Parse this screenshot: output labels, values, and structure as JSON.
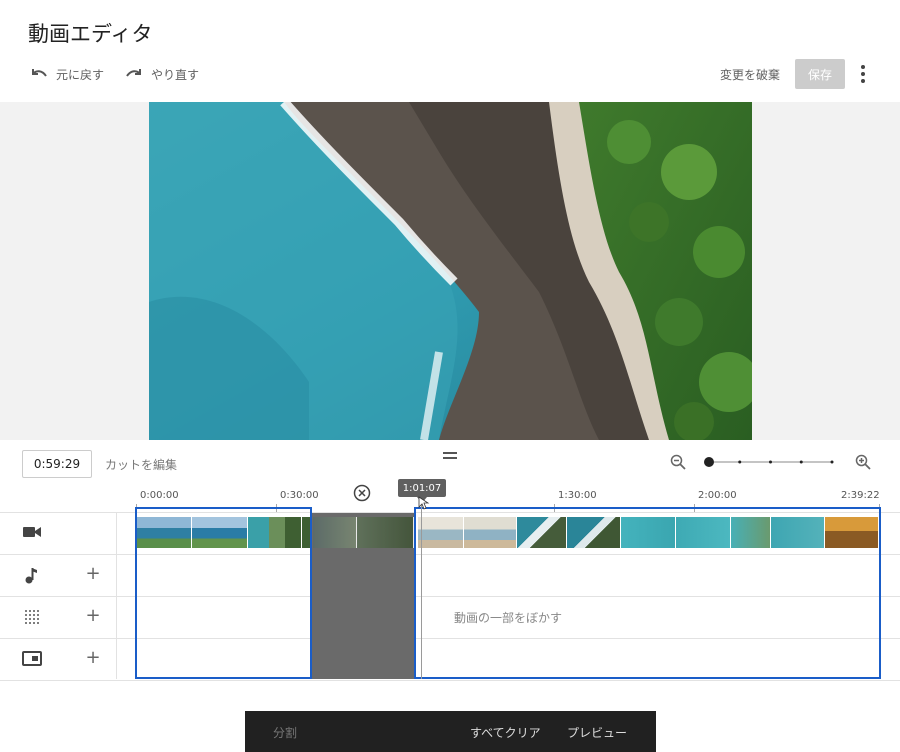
{
  "header": {
    "title": "動画エディタ",
    "undo_label": "元に戻す",
    "redo_label": "やり直す",
    "discard_label": "変更を破棄",
    "save_label": "保存"
  },
  "controls": {
    "timecode": "0:59:29",
    "cut_edit_label": "カットを編集",
    "zoom_steps": 5,
    "zoom_level": 1
  },
  "ruler": {
    "labels": [
      "0:00:00",
      "0:30:00",
      "1:30:00",
      "2:00:00",
      "2:39:22"
    ],
    "playhead_time": "1:01:07"
  },
  "tracks": {
    "video_icon": "video-camera-icon",
    "audio_icon": "music-note-icon",
    "blur_icon": "blur-grid-icon",
    "info_icon": "info-card-icon",
    "blur_label": "動画の一部をぼかす"
  },
  "bottom_bar": {
    "split_label": "分割",
    "clear_all_label": "すべてクリア",
    "preview_label": "プレビュー"
  },
  "colors": {
    "selection": "#1a5dc8",
    "cut_region": "#6a6a6a",
    "save_disabled": "#cccccc",
    "bottom_bar": "#212121"
  }
}
